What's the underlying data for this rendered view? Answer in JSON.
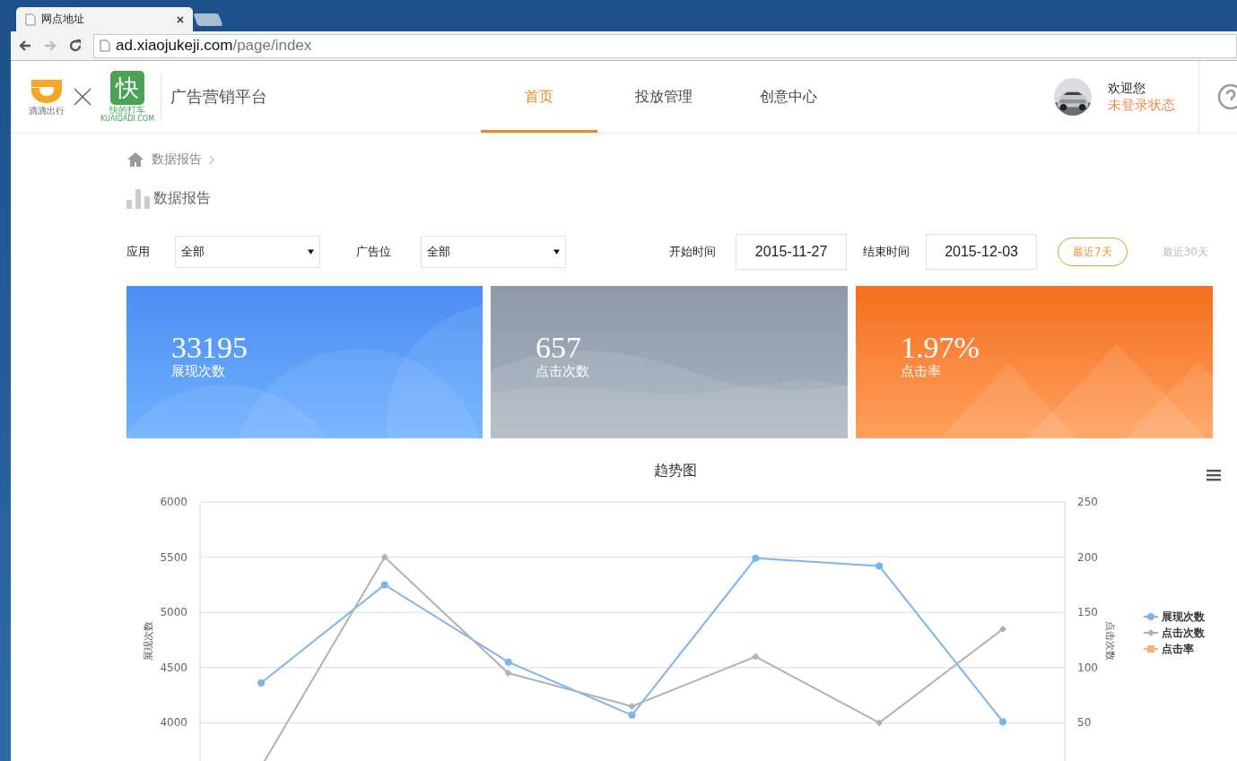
{
  "browser": {
    "tab_title": "网点地址",
    "url_host": "ad.xiaojukeji.com",
    "url_path": "/page/index"
  },
  "header": {
    "logo_left_text": "滴滴出行",
    "logo_right_char": "快",
    "logo_right_text": "快的打车",
    "logo_right_domain": "KUAIDADI.COM",
    "platform": "广告营销平台",
    "nav": [
      {
        "label": "首页",
        "selected": true
      },
      {
        "label": "投放管理",
        "selected": false
      },
      {
        "label": "创意中心",
        "selected": false
      }
    ],
    "user": {
      "greeting": "欢迎您",
      "status": "未登录状态"
    }
  },
  "breadcrumb": {
    "items": [
      "数据报告"
    ]
  },
  "page_title": "数据报告",
  "filters": {
    "app_label": "应用",
    "app_value": "全部",
    "slot_label": "广告位",
    "slot_value": "全部",
    "start_label": "开始时间",
    "start_value": "2015-11-27",
    "end_label": "结束时间",
    "end_value": "2015-12-03",
    "ranges": [
      {
        "label": "最近7天",
        "selected": true
      },
      {
        "label": "最近30天",
        "selected": false
      }
    ]
  },
  "stats": [
    {
      "kind": "blue",
      "value": "33195",
      "label": "展现次数"
    },
    {
      "kind": "gray",
      "value": "657",
      "label": "点击次数"
    },
    {
      "kind": "orange",
      "value": "1.97%",
      "label": "点击率"
    }
  ],
  "chart": {
    "chart_data": {
      "type": "line",
      "title": "趋势图",
      "ylabel": "展现次数",
      "y2label": "点击次数",
      "ylim": [
        3500,
        6000
      ],
      "y2lim": [
        0,
        250
      ],
      "yticks": [
        4000,
        4500,
        5000,
        5500,
        6000
      ],
      "y2ticks": [
        50,
        100,
        150,
        200,
        250
      ],
      "grid": true,
      "legend": true,
      "series": [
        {
          "name": "展现次数",
          "color": "#7cb5ec",
          "marker": "circle",
          "values": [
            4360,
            5250,
            4550,
            4070,
            5490,
            5420,
            4010
          ]
        },
        {
          "name": "点击次数",
          "color": "#aab2bd",
          "axis": "y2",
          "marker": "diamond",
          "values": [
            10,
            200,
            95,
            65,
            110,
            50,
            135
          ]
        },
        {
          "name": "点击率",
          "color": "#f7b27a",
          "marker": "square",
          "values": [
            null,
            null,
            null,
            null,
            null,
            null,
            null
          ]
        }
      ]
    }
  }
}
